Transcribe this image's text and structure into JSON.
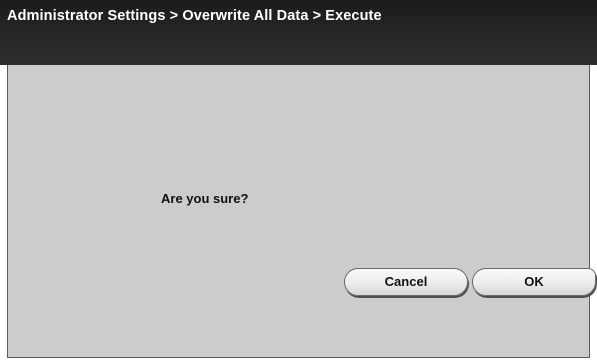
{
  "header": {
    "breadcrumb": "Administrator Settings > Overwrite All Data > Execute"
  },
  "dialog": {
    "message": "Are you sure?"
  },
  "buttons": {
    "cancel_label": "Cancel",
    "ok_label": "OK"
  },
  "colors": {
    "header_background": "#262626",
    "panel_background": "#cccccc",
    "text_light": "#ffffff",
    "text_dark": "#111111"
  }
}
